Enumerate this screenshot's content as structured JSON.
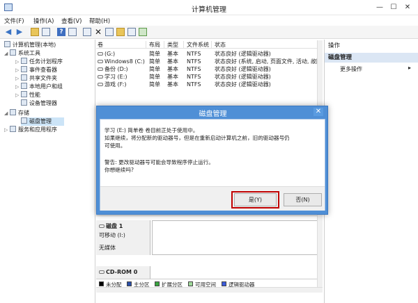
{
  "window": {
    "title": "计算机管理",
    "minimize": "—",
    "maximize": "☐",
    "close": "✕"
  },
  "menu": [
    "文件(F)",
    "操作(A)",
    "查看(V)",
    "帮助(H)"
  ],
  "tree": {
    "root": "计算机管理(本地)",
    "items": [
      {
        "label": "系统工具",
        "level": 1
      },
      {
        "label": "任务计划程序",
        "level": 2
      },
      {
        "label": "事件查看器",
        "level": 2
      },
      {
        "label": "共享文件夹",
        "level": 2
      },
      {
        "label": "本地用户和组",
        "level": 2
      },
      {
        "label": "性能",
        "level": 2
      },
      {
        "label": "设备管理器",
        "level": 2
      },
      {
        "label": "存储",
        "level": 1
      },
      {
        "label": "磁盘管理",
        "level": 2,
        "selected": true
      },
      {
        "label": "服务和应用程序",
        "level": 1
      }
    ]
  },
  "volumes": {
    "headers": [
      "卷",
      "布局",
      "类型",
      "文件系统",
      "状态"
    ],
    "rows": [
      [
        "(G:)",
        "简单",
        "基本",
        "NTFS",
        "状态良好 (逻辑驱动器)"
      ],
      [
        "Windows8 (C:)",
        "简单",
        "基本",
        "NTFS",
        "状态良好 (系统, 启动, 页面文件, 活动, 故障"
      ],
      [
        "备份 (D:)",
        "简单",
        "基本",
        "NTFS",
        "状态良好 (逻辑驱动器)"
      ],
      [
        "学习 (E:)",
        "简单",
        "基本",
        "NTFS",
        "状态良好 (逻辑驱动器)"
      ],
      [
        "游戏 (F:)",
        "简单",
        "基本",
        "NTFS",
        "状态良好 (逻辑驱动器)"
      ]
    ]
  },
  "disks": [
    {
      "name": "磁盘 1",
      "type": "可移动 (I:)",
      "status": "无媒体"
    },
    {
      "name": "CD-ROM 0",
      "type": "",
      "status": ""
    }
  ],
  "legend": [
    {
      "label": "未分配",
      "color": "#000000"
    },
    {
      "label": "主分区",
      "color": "#2b4fa8"
    },
    {
      "label": "扩展分区",
      "color": "#3aa640"
    },
    {
      "label": "可用空间",
      "color": "#9fd99a"
    },
    {
      "label": "逻辑驱动器",
      "color": "#3b5bdb"
    }
  ],
  "actions": {
    "header": "操作",
    "section": "磁盘管理",
    "more": "更多操作",
    "more_arrow": "▸"
  },
  "dialog": {
    "title": "磁盘管理",
    "close": "✕",
    "lines": [
      "学习 (E:) 简单卷 卷目前正处于使用中。",
      "如果继续，将分配新的驱动器号，但是在重新启动计算机之前，旧的驱动器号仍",
      "可使用。",
      "警告: 更改驱动器号可能会导致程序停止运行。",
      "你想继续吗?"
    ],
    "yes": "是(Y)",
    "no": "否(N)"
  }
}
